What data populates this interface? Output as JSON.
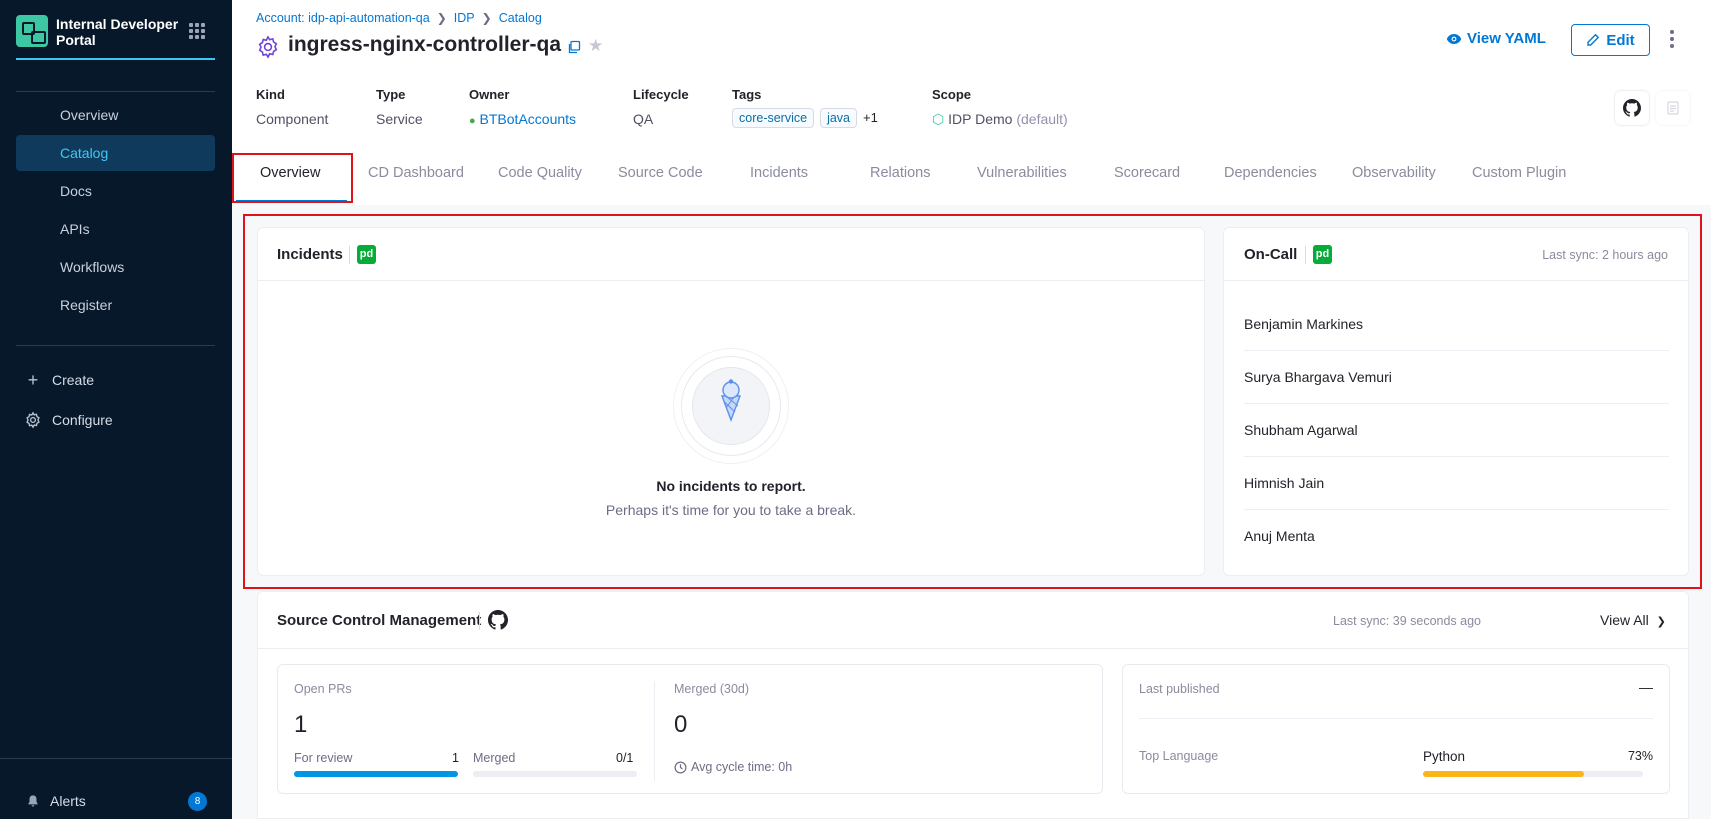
{
  "sidebar": {
    "brand": "Internal Developer Portal",
    "items": [
      {
        "label": "Overview"
      },
      {
        "label": "Catalog",
        "active": true
      },
      {
        "label": "Docs"
      },
      {
        "label": "APIs"
      },
      {
        "label": "Workflows"
      },
      {
        "label": "Register"
      }
    ],
    "create_label": "Create",
    "configure_label": "Configure",
    "alerts_label": "Alerts",
    "alerts_count": "8"
  },
  "breadcrumb": {
    "account": "Account: idp-api-automation-qa",
    "idp": "IDP",
    "catalog": "Catalog"
  },
  "entity": {
    "title": "ingress-nginx-controller-qa",
    "view_yaml_label": "View YAML",
    "edit_label": "Edit"
  },
  "meta": {
    "kind_label": "Kind",
    "kind": "Component",
    "type_label": "Type",
    "type": "Service",
    "owner_label": "Owner",
    "owner": "BTBotAccounts",
    "lifecycle_label": "Lifecycle",
    "lifecycle": "QA",
    "tags_label": "Tags",
    "tags": [
      "core-service",
      "java"
    ],
    "tags_more": "+1",
    "scope_label": "Scope",
    "scope": "IDP Demo",
    "scope_suffix": "(default)"
  },
  "tabs": [
    {
      "label": "Overview",
      "active": true
    },
    {
      "label": "CD Dashboard"
    },
    {
      "label": "Code Quality"
    },
    {
      "label": "Source Code"
    },
    {
      "label": "Incidents"
    },
    {
      "label": "Relations"
    },
    {
      "label": "Vulnerabilities"
    },
    {
      "label": "Scorecard"
    },
    {
      "label": "Dependencies"
    },
    {
      "label": "Observability"
    },
    {
      "label": "Custom Plugin"
    }
  ],
  "incidents": {
    "title": "Incidents",
    "pd_badge": "pd",
    "empty_title": "No incidents to report.",
    "empty_sub": "Perhaps it's time for you to take a break."
  },
  "oncall": {
    "title": "On-Call",
    "pd_badge": "pd",
    "last_sync": "Last sync: 2 hours ago",
    "people": [
      "Benjamin Markines",
      "Surya Bhargava Vemuri",
      "Shubham Agarwal",
      "Himnish Jain",
      "Anuj Menta"
    ]
  },
  "scm": {
    "title": "Source Control Management",
    "last_sync": "Last sync: 39 seconds ago",
    "view_all": "View All",
    "open_prs_label": "Open PRs",
    "open_prs": "1",
    "for_review_label": "For review",
    "for_review": "1",
    "merged_label": "Merged",
    "merged_ratio": "0/1",
    "merged30_label": "Merged (30d)",
    "merged30": "0",
    "avg_cycle": "Avg cycle time: 0h",
    "last_published_label": "Last published",
    "last_published": "—",
    "top_language_label": "Top Language",
    "top_language": "Python",
    "top_language_pct": "73%",
    "top_language_fraction": 0.73,
    "for_review_fraction": 1.0,
    "merged_fraction": 0.0,
    "colors": {
      "review_bar": "#0295e5",
      "language_bar": "#fcb519"
    }
  }
}
